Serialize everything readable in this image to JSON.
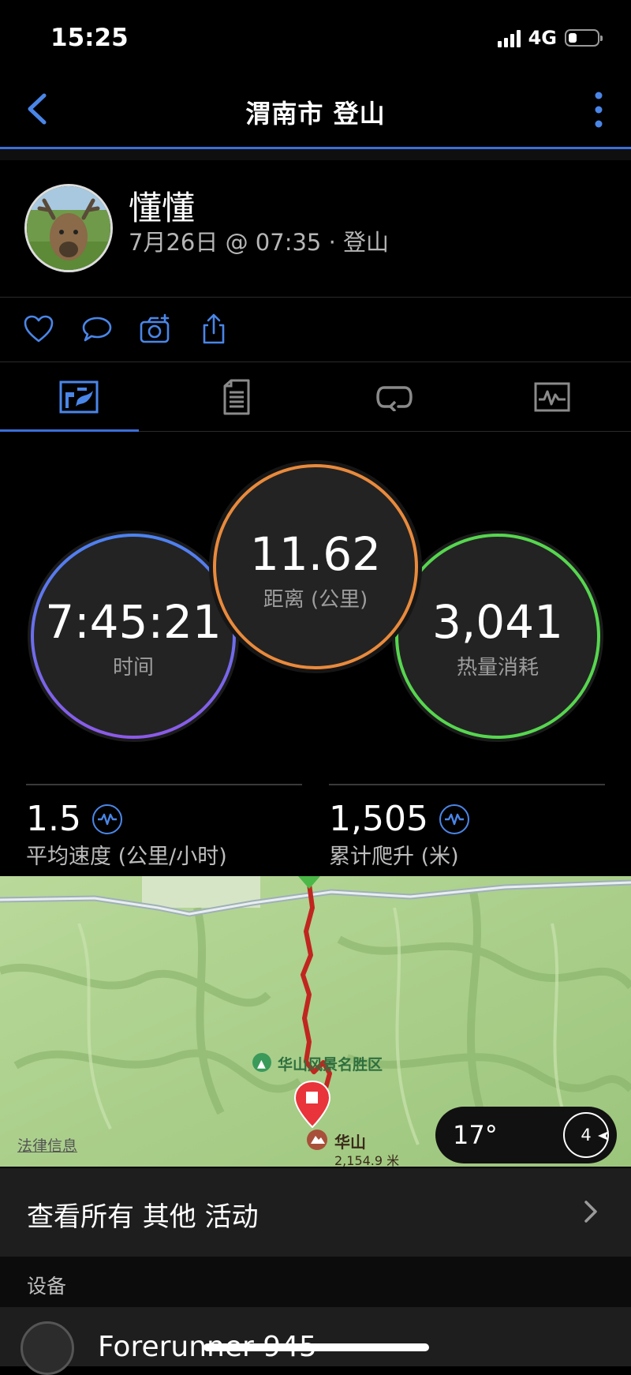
{
  "status_bar": {
    "time": "15:25",
    "network": "4G"
  },
  "nav": {
    "title": "渭南市 登山"
  },
  "activity": {
    "user_name": "懂懂",
    "meta": "7月26日 @ 07:35 · 登山"
  },
  "tabs": [
    {
      "name": "summary",
      "icon": "map-stats-icon",
      "active": true
    },
    {
      "name": "details",
      "icon": "document-icon",
      "active": false
    },
    {
      "name": "laps",
      "icon": "loop-icon",
      "active": false
    },
    {
      "name": "charts",
      "icon": "chart-icon",
      "active": false
    }
  ],
  "circles": {
    "time": {
      "value": "7:45:21",
      "label": "时间",
      "color": "#5b7ff0"
    },
    "distance": {
      "value": "11.62",
      "label": "距离 (公里)",
      "color": "#e98a3c"
    },
    "calories": {
      "value": "3,041",
      "label": "热量消耗",
      "color": "#56d64f"
    }
  },
  "stats": [
    {
      "value": "1.5",
      "label": "平均速度 (公里/小时)"
    },
    {
      "value": "1,505",
      "label": "累计爬升 (米)"
    }
  ],
  "map": {
    "poi_label": "华山风景名胜区",
    "peak_name": "华山",
    "peak_elevation": "2,154.9 米",
    "legal": "法律信息",
    "weather_temp": "17°",
    "wind_speed": "4"
  },
  "view_all": {
    "label": "查看所有 其他 活动"
  },
  "devices_section": {
    "header": "设备",
    "device_name": "Forerunner 945"
  },
  "colors": {
    "accent": "#3b6fd8",
    "route": "#c0261f"
  }
}
